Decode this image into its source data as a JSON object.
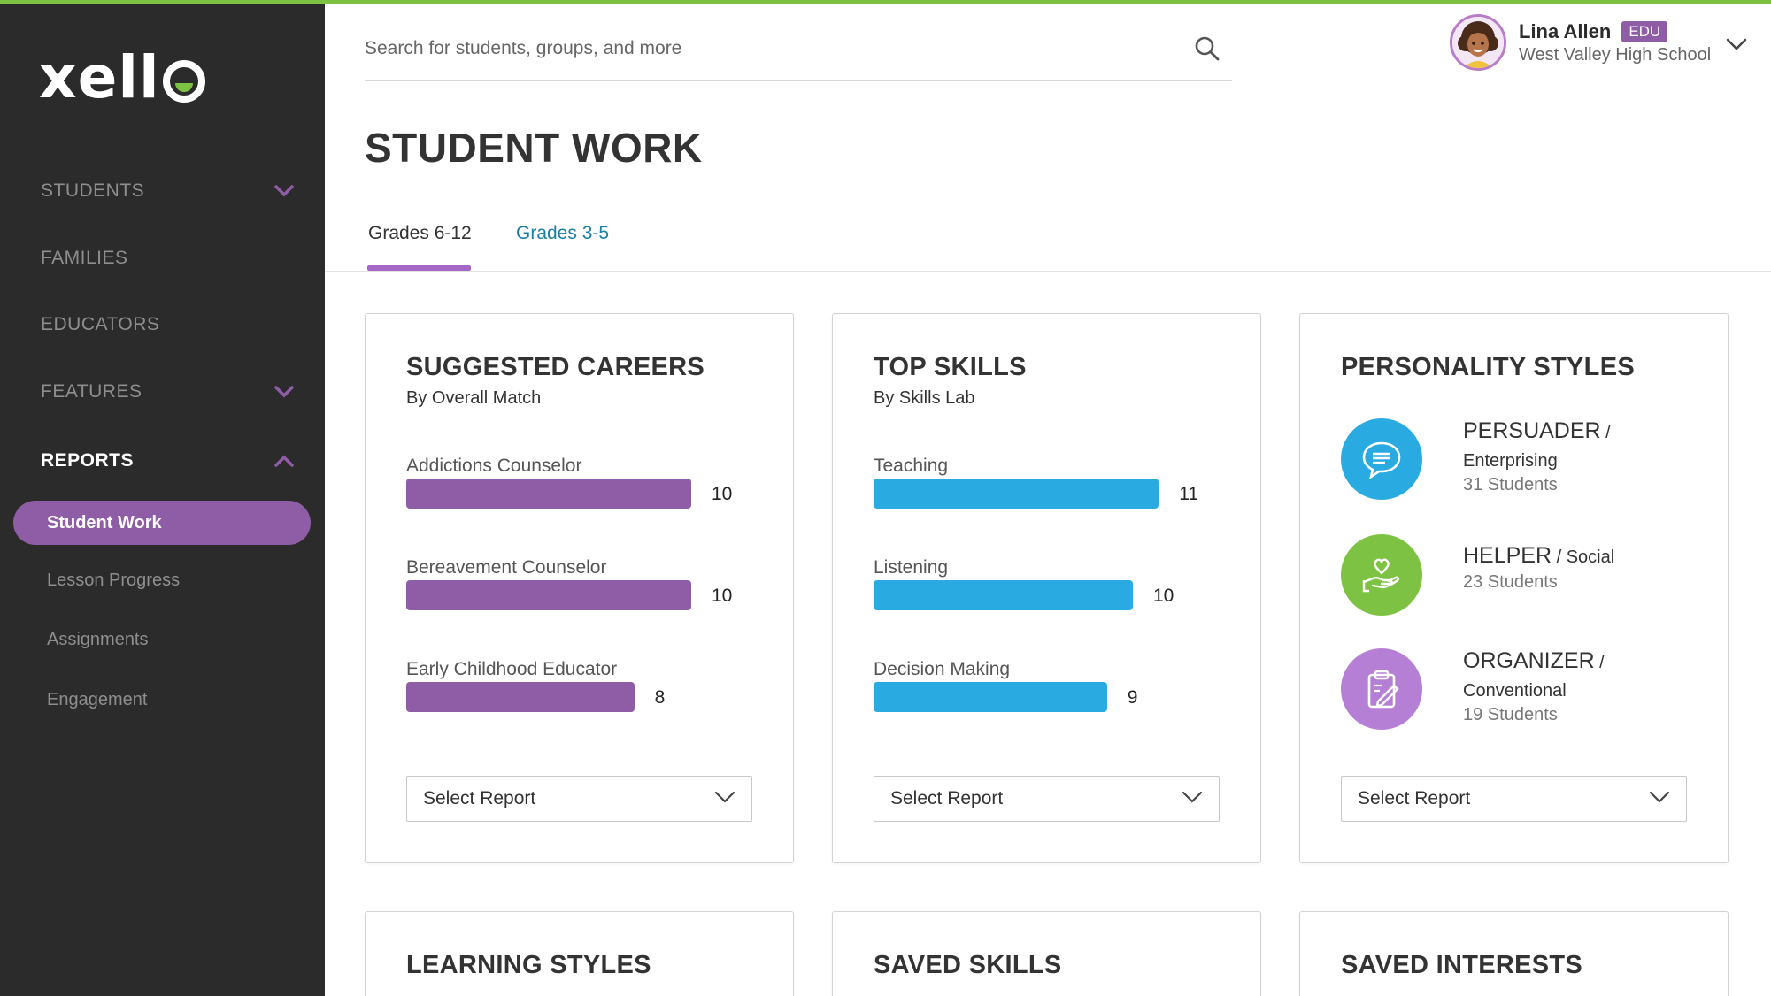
{
  "app": {
    "logo_text": "xell",
    "accent": "#8f5ca6",
    "brand_green": "#7dc242"
  },
  "sidebar": {
    "items": [
      {
        "label": "STUDENTS",
        "icon": "chevron-down-icon"
      },
      {
        "label": "FAMILIES"
      },
      {
        "label": "EDUCATORS"
      },
      {
        "label": "FEATURES",
        "icon": "chevron-down-icon"
      },
      {
        "label": "REPORTS",
        "icon": "chevron-up-icon"
      }
    ],
    "subitems": [
      "Student Work",
      "Lesson Progress",
      "Assignments",
      "Engagement"
    ]
  },
  "header": {
    "search_placeholder": "Search for students, groups, and more",
    "user_name": "Lina Allen",
    "user_badge": "EDU",
    "user_school": "West Valley High School"
  },
  "main": {
    "title": "STUDENT WORK",
    "tabs": [
      {
        "label": "Grades 6-12",
        "active": true
      },
      {
        "label": "Grades 3-5",
        "active": false
      }
    ]
  },
  "cards": {
    "careers": {
      "title": "SUGGESTED CAREERS",
      "subtitle": "By Overall Match",
      "color": "#8f5ca6",
      "select_label": "Select Report"
    },
    "skills": {
      "title": "TOP SKILLS",
      "subtitle": "By Skills Lab",
      "color": "#29abe2",
      "select_label": "Select Report"
    },
    "personality": {
      "title": "PERSONALITY STYLES",
      "select_label": "Select Report",
      "styles": [
        {
          "name": "PERSUADER",
          "sep": " /",
          "category": "Enterprising",
          "count": "31 Students",
          "color": "#29abe2",
          "icon": "speech-bubble-icon"
        },
        {
          "name": "HELPER",
          "sep": " / ",
          "category": "Social",
          "count": "23 Students",
          "color": "#7dc242",
          "icon": "heart-hand-icon"
        },
        {
          "name": "ORGANIZER",
          "sep": " /",
          "category": "Conventional",
          "count": "19 Students",
          "color": "#b57fd6",
          "icon": "clipboard-icon"
        }
      ]
    },
    "learning": {
      "title": "LEARNING STYLES"
    },
    "saved_skills": {
      "title": "SAVED SKILLS"
    },
    "saved_interests": {
      "title": "SAVED INTERESTS"
    }
  },
  "chart_data": [
    {
      "type": "bar",
      "title": "SUGGESTED CAREERS",
      "subtitle": "By Overall Match",
      "categories": [
        "Addictions Counselor",
        "Bereavement Counselor",
        "Early Childhood Educator"
      ],
      "values": [
        10,
        10,
        8
      ]
    },
    {
      "type": "bar",
      "title": "TOP SKILLS",
      "subtitle": "By Skills Lab",
      "categories": [
        "Teaching",
        "Listening",
        "Decision Making"
      ],
      "values": [
        11,
        10,
        9
      ]
    }
  ]
}
